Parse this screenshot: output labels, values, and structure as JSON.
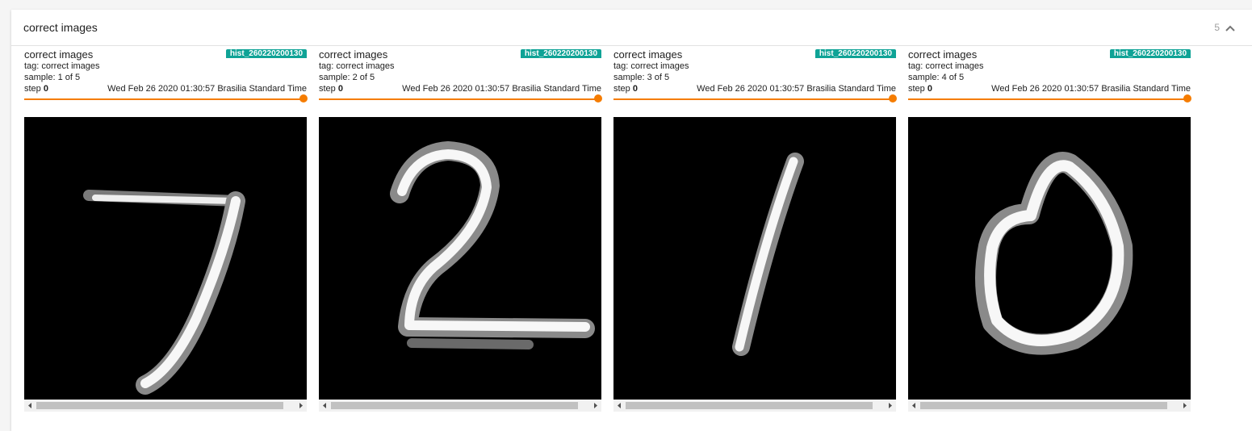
{
  "category": {
    "title": "correct images",
    "count": "5"
  },
  "cards": [
    {
      "title": "correct images",
      "run": "hist_260220200130",
      "tag": "tag: correct images",
      "sample": "sample: 1 of 5",
      "step_label": "step ",
      "step_value": "0",
      "timestamp": "Wed Feb 26 2020 01:30:57 Brasilia Standard Time",
      "digit": "7"
    },
    {
      "title": "correct images",
      "run": "hist_260220200130",
      "tag": "tag: correct images",
      "sample": "sample: 2 of 5",
      "step_label": "step ",
      "step_value": "0",
      "timestamp": "Wed Feb 26 2020 01:30:57 Brasilia Standard Time",
      "digit": "2"
    },
    {
      "title": "correct images",
      "run": "hist_260220200130",
      "tag": "tag: correct images",
      "sample": "sample: 3 of 5",
      "step_label": "step ",
      "step_value": "0",
      "timestamp": "Wed Feb 26 2020 01:30:57 Brasilia Standard Time",
      "digit": "1"
    },
    {
      "title": "correct images",
      "run": "hist_260220200130",
      "tag": "tag: correct images",
      "sample": "sample: 4 of 5",
      "step_label": "step ",
      "step_value": "0",
      "timestamp": "Wed Feb 26 2020 01:30:57 Brasilia Standard Time",
      "digit": "0"
    }
  ],
  "colors": {
    "run_badge": "#0fa396",
    "slider": "#f57c00",
    "image_background": "#000000"
  },
  "icons": {
    "collapse": "chevron-up-icon",
    "scroll_left": "caret-left-icon",
    "scroll_right": "caret-right-icon"
  }
}
